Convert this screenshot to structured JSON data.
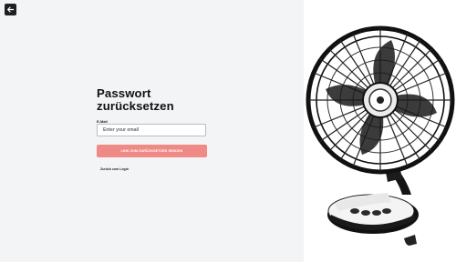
{
  "nav": {
    "back_icon": "arrow-left-icon"
  },
  "form": {
    "title_line1": "Passwort",
    "title_line2": "zurücksetzen",
    "email_label": "E-Mail",
    "email_placeholder": "Enter your email",
    "email_value": "",
    "submit_label": "LINK ZUM ZURÜCKSETZEN SENDEN",
    "login_link": "Zurück zum Login"
  },
  "hero": {
    "image": "desk-fan-illustration"
  },
  "colors": {
    "panel_bg": "#f3f4f6",
    "accent": "#f08a86",
    "back_button": "#1f1f1f"
  }
}
